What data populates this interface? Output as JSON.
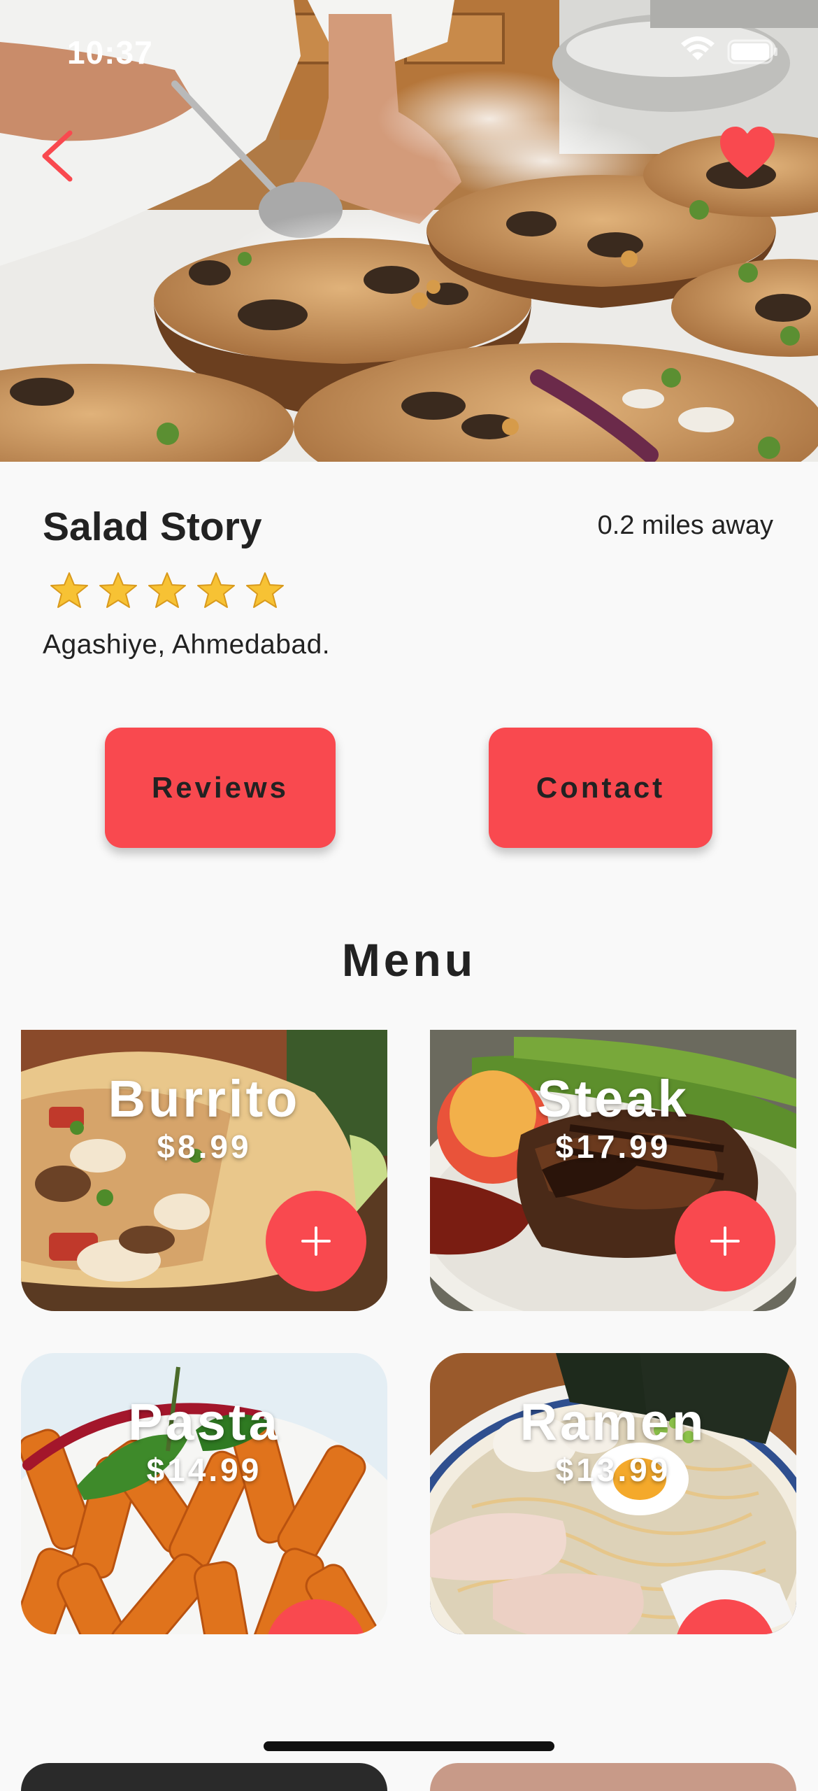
{
  "status_bar": {
    "time": "10:37",
    "wifi_icon": "wifi-icon",
    "battery_icon": "battery-icon"
  },
  "hero": {
    "back_icon": "chevron-left-icon",
    "favorite_icon": "heart-icon",
    "favorited": true,
    "image": "chef plating dishes on wooden slabs"
  },
  "restaurant": {
    "name": "Salad Story",
    "distance": "0.2 miles away",
    "rating": 5,
    "address": "Agashiye, Ahmedabad."
  },
  "actions": {
    "reviews_label": "Reviews",
    "contact_label": "Contact"
  },
  "menu": {
    "title": "Menu",
    "add_label": "+",
    "items": [
      {
        "name": "Burrito",
        "price": "$8.99"
      },
      {
        "name": "Steak",
        "price": "$17.99"
      },
      {
        "name": "Pasta",
        "price": "$14.99"
      },
      {
        "name": "Ramen",
        "price": "$13.99"
      }
    ]
  },
  "colors": {
    "accent": "#f9494f",
    "text": "#222222",
    "background": "#f9f9f9",
    "star": "#f7c234"
  }
}
